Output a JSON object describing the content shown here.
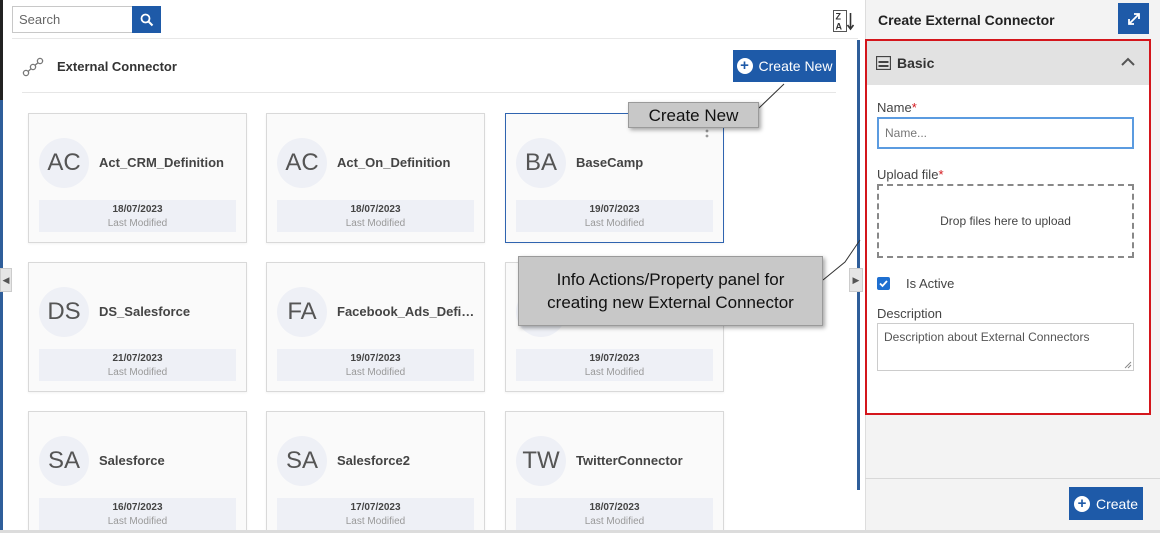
{
  "search": {
    "placeholder": "Search"
  },
  "section": {
    "title": "External Connector",
    "create_new_label": "Create New"
  },
  "cards": [
    {
      "initials": "AC",
      "name": "Act_CRM_Definition",
      "date": "18/07/2023",
      "modified_label": "Last Modified"
    },
    {
      "initials": "AC",
      "name": "Act_On_Definition",
      "date": "18/07/2023",
      "modified_label": "Last Modified"
    },
    {
      "initials": "BA",
      "name": "BaseCamp",
      "date": "19/07/2023",
      "modified_label": "Last Modified"
    },
    {
      "initials": "DS",
      "name": "DS_Salesforce",
      "date": "21/07/2023",
      "modified_label": "Last Modified"
    },
    {
      "initials": "FA",
      "name": "Facebook_Ads_Defini…",
      "date": "19/07/2023",
      "modified_label": "Last Modified"
    },
    {
      "initials": "",
      "name": "",
      "date": "19/07/2023",
      "modified_label": "Last Modified"
    },
    {
      "initials": "SA",
      "name": "Salesforce",
      "date": "16/07/2023",
      "modified_label": "Last Modified"
    },
    {
      "initials": "SA",
      "name": "Salesforce2",
      "date": "17/07/2023",
      "modified_label": "Last Modified"
    },
    {
      "initials": "TW",
      "name": "TwitterConnector",
      "date": "18/07/2023",
      "modified_label": "Last Modified"
    }
  ],
  "callouts": {
    "create_new": "Create New",
    "info_panel_line1": "Info Actions/Property panel for",
    "info_panel_line2": "creating new External Connector"
  },
  "panel": {
    "title": "Create External Connector",
    "section_label": "Basic",
    "name_label": "Name",
    "name_placeholder": "Name...",
    "upload_label": "Upload file",
    "drop_text": "Drop files here to upload",
    "is_active_label": "Is Active",
    "description_label": "Description",
    "description_value": "Description about External Connectors",
    "create_label": "Create",
    "required_mark": "*"
  },
  "colors": {
    "accent": "#1e5aa8",
    "highlight": "#d4161c",
    "callout": "#c8c8c8"
  }
}
